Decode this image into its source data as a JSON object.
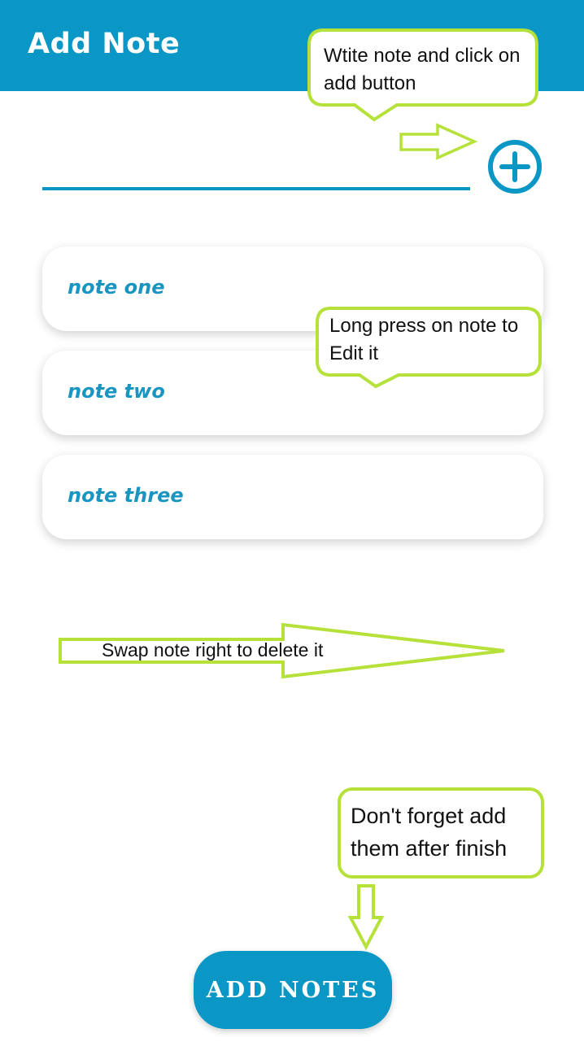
{
  "appbar": {
    "title": "Add Note",
    "color": "#0b97c6"
  },
  "input": {
    "value": "",
    "placeholder": ""
  },
  "add_icon": "plus-circle-icon",
  "notes": [
    {
      "label": "note one"
    },
    {
      "label": "note two"
    },
    {
      "label": "note three"
    }
  ],
  "hints": {
    "write_note": "Wtite note and click on add button",
    "long_press": "Long press on note to Edit it",
    "swipe": "Swap note right to delete it",
    "dont_forget": "Don't forget add them after finish"
  },
  "add_notes_button": "ADD NOTES",
  "colors": {
    "primary": "#0b97c6",
    "note_text": "#1a95c2",
    "callout_border": "#b5e13a"
  }
}
